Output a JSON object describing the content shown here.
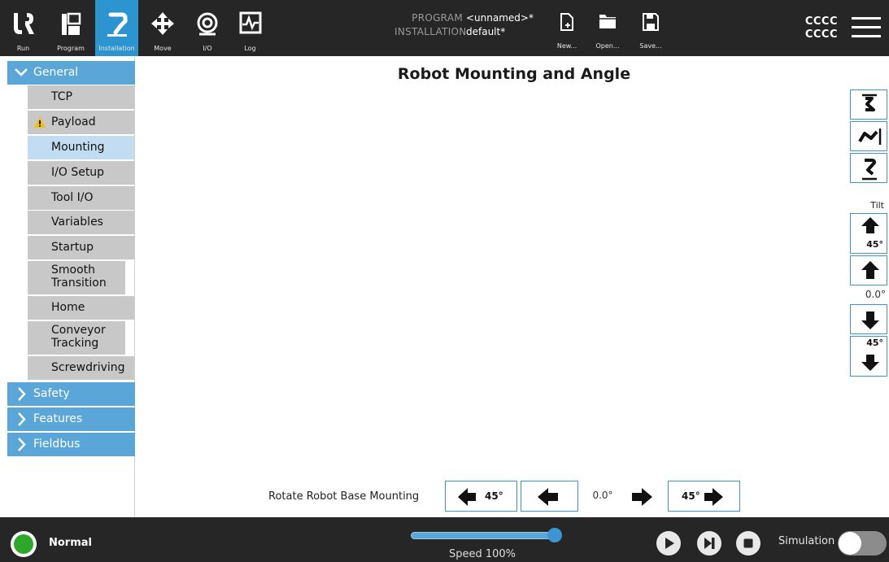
{
  "topbar": {
    "nav": [
      {
        "id": "run",
        "label": "Run",
        "icon": "ur-logo-icon"
      },
      {
        "id": "program",
        "label": "Program",
        "icon": "program-icon"
      },
      {
        "id": "installation",
        "label": "Installation",
        "icon": "installation-icon",
        "active": true
      },
      {
        "id": "move",
        "label": "Move",
        "icon": "move-icon"
      },
      {
        "id": "io",
        "label": "I/O",
        "icon": "io-icon"
      },
      {
        "id": "log",
        "label": "Log",
        "icon": "log-icon"
      }
    ],
    "program_key": "PROGRAM",
    "program_value": "<unnamed>*",
    "installation_key": "INSTALLATION",
    "installation_value": "default*",
    "file_buttons": [
      {
        "id": "new",
        "label": "New..."
      },
      {
        "id": "open",
        "label": "Open..."
      },
      {
        "id": "save",
        "label": "Save..."
      }
    ],
    "user_line1": "CCCC",
    "user_line2": "CCCC",
    "accent": "#2c95cf",
    "bar_color": "#262626"
  },
  "sidebar": {
    "general_label": "General",
    "general_items": [
      {
        "label": "TCP"
      },
      {
        "label": "Payload",
        "warning": true
      },
      {
        "label": "Mounting",
        "selected": true
      },
      {
        "label": "I/O Setup"
      },
      {
        "label": "Tool I/O"
      },
      {
        "label": "Variables"
      },
      {
        "label": "Startup"
      },
      {
        "label": "Smooth Transition"
      },
      {
        "label": "Home"
      },
      {
        "label": "Conveyor Tracking"
      },
      {
        "label": "Screwdriving"
      }
    ],
    "sections": [
      {
        "label": "Safety"
      },
      {
        "label": "Features"
      },
      {
        "label": "Fieldbus"
      }
    ],
    "section_color": "#5aa6d8",
    "selected_color": "#c2ddf2"
  },
  "main": {
    "title": "Robot Mounting and Angle",
    "tilt_label": "Tilt",
    "tilt_up_45": "45°",
    "tilt_value": "0.0°",
    "tilt_down_45": "45°",
    "rotate_label": "Rotate Robot Base Mounting",
    "rotate_left_45": "45°",
    "rotate_value": "0.0°",
    "rotate_right_45": "45°"
  },
  "bottombar": {
    "status": "Normal",
    "speed_label": "Speed 100%",
    "speed_fraction": 1.0,
    "simulation_label": "Simulation",
    "simulation_on": false,
    "status_color": "#2ea82b"
  }
}
